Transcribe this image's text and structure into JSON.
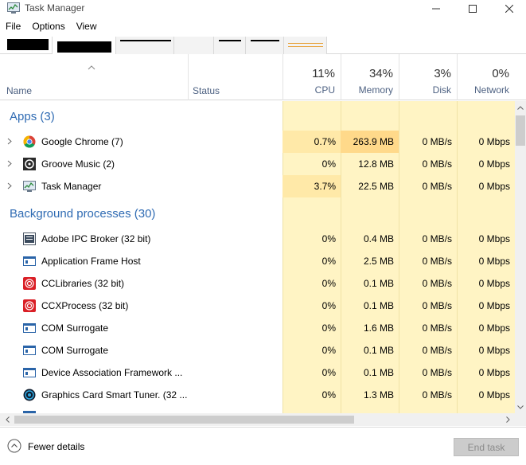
{
  "window": {
    "title": "Task Manager"
  },
  "menu": {
    "items": [
      "File",
      "Options",
      "View"
    ]
  },
  "header": {
    "name_label": "Name",
    "status_label": "Status",
    "cpu": {
      "percent": "11%",
      "label": "CPU"
    },
    "memory": {
      "percent": "34%",
      "label": "Memory"
    },
    "disk": {
      "percent": "3%",
      "label": "Disk"
    },
    "network": {
      "percent": "0%",
      "label": "Network"
    }
  },
  "groups": {
    "apps": "Apps (3)",
    "background": "Background processes (30)"
  },
  "apps": [
    {
      "name": "Google Chrome (7)",
      "cpu": "0.7%",
      "memory": "263.9 MB",
      "disk": "0 MB/s",
      "network": "0 Mbps",
      "icon": "chrome-icon"
    },
    {
      "name": "Groove Music (2)",
      "cpu": "0%",
      "memory": "12.8 MB",
      "disk": "0 MB/s",
      "network": "0 Mbps",
      "icon": "groove-music-icon"
    },
    {
      "name": "Task Manager",
      "cpu": "3.7%",
      "memory": "22.5 MB",
      "disk": "0 MB/s",
      "network": "0 Mbps",
      "icon": "task-manager-icon"
    }
  ],
  "background": [
    {
      "name": "Adobe IPC Broker (32 bit)",
      "cpu": "0%",
      "memory": "0.4 MB",
      "disk": "0 MB/s",
      "network": "0 Mbps",
      "icon": "adobe-ipc-icon"
    },
    {
      "name": "Application Frame Host",
      "cpu": "0%",
      "memory": "2.5 MB",
      "disk": "0 MB/s",
      "network": "0 Mbps",
      "icon": "window-process-icon"
    },
    {
      "name": "CCLibraries (32 bit)",
      "cpu": "0%",
      "memory": "0.1 MB",
      "disk": "0 MB/s",
      "network": "0 Mbps",
      "icon": "creative-cloud-icon"
    },
    {
      "name": "CCXProcess (32 bit)",
      "cpu": "0%",
      "memory": "0.1 MB",
      "disk": "0 MB/s",
      "network": "0 Mbps",
      "icon": "creative-cloud-icon"
    },
    {
      "name": "COM Surrogate",
      "cpu": "0%",
      "memory": "1.6 MB",
      "disk": "0 MB/s",
      "network": "0 Mbps",
      "icon": "window-process-icon"
    },
    {
      "name": "COM Surrogate",
      "cpu": "0%",
      "memory": "0.1 MB",
      "disk": "0 MB/s",
      "network": "0 Mbps",
      "icon": "window-process-icon"
    },
    {
      "name": "Device Association Framework ...",
      "cpu": "0%",
      "memory": "0.1 MB",
      "disk": "0 MB/s",
      "network": "0 Mbps",
      "icon": "window-process-icon"
    },
    {
      "name": "Graphics Card Smart Tuner. (32 ...",
      "cpu": "0%",
      "memory": "1.3 MB",
      "disk": "0 MB/s",
      "network": "0 Mbps",
      "icon": "graphics-tuner-icon"
    }
  ],
  "footer": {
    "fewer_details": "Fewer details",
    "end_task": "End task"
  },
  "colors": {
    "heat_low": "#fff4c4",
    "heat_mid": "#ffe9a8",
    "group_blue": "#2f6bb3",
    "header_label": "#4d6182"
  }
}
